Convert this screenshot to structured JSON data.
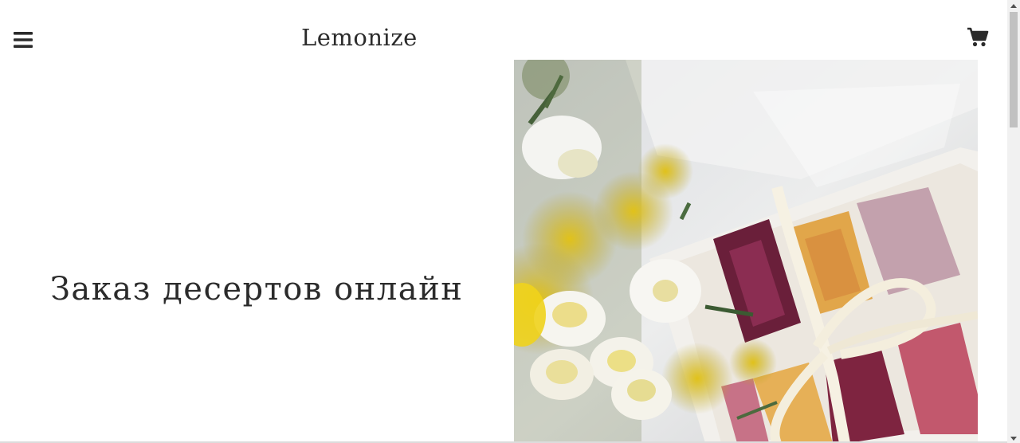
{
  "header": {
    "brand": "Lemonize",
    "menu_icon": "hamburger-menu-icon",
    "cart_icon": "shopping-cart-icon"
  },
  "hero": {
    "title": "Заказ десертов онлайн",
    "image_alt": "Dessert box with flowers"
  },
  "colors": {
    "text": "#2b2b2b",
    "background": "#ffffff"
  }
}
